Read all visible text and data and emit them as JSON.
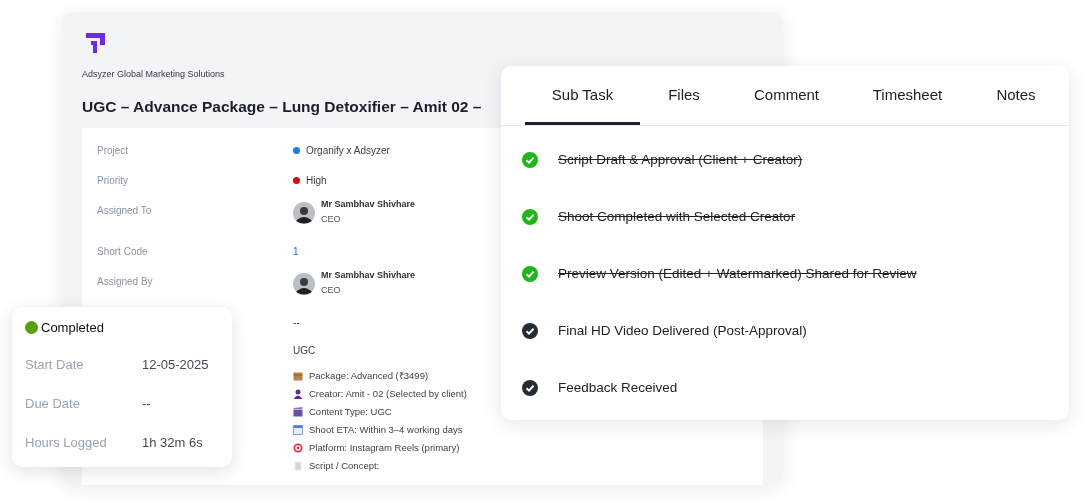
{
  "company": "Adsyzer Global Marketing Solutions",
  "title": "UGC – Advance Package – Lung Detoxifier – Amit 02 –",
  "details": [
    {
      "kind": "dot",
      "label": "Project",
      "value": "Organify x Adsyzer",
      "color": "#1a7cf0"
    },
    {
      "kind": "dot",
      "label": "Priority",
      "value": "High",
      "color": "#d40d0d"
    },
    {
      "kind": "person",
      "label": "Assigned To",
      "name": "Mr Sambhav Shivhare",
      "role": "CEO"
    },
    {
      "kind": "link",
      "label": "Short Code",
      "value": "1"
    },
    {
      "kind": "person",
      "label": "Assigned By",
      "name": "Mr Sambhav Shivhare",
      "role": "CEO"
    },
    {
      "kind": "text",
      "value": "--"
    },
    {
      "kind": "text",
      "value": "UGC"
    },
    {
      "kind": "list",
      "items": [
        {
          "text": "Package: Advanced (₹3499)"
        },
        {
          "text": "Creator: Amit - 02 (Selected by client)"
        },
        {
          "text": "Content Type: UGC"
        },
        {
          "text": "Shoot ETA: Within 3–4 working days"
        },
        {
          "text": "Platform: Instagram Reels (primary)"
        },
        {
          "text": "Script / Concept:"
        }
      ]
    }
  ],
  "status": {
    "label": "Completed",
    "color": "#5a9e0f",
    "rows": [
      {
        "label": "Start Date",
        "value": "12-05-2025"
      },
      {
        "label": "Due Date",
        "value": "--"
      },
      {
        "label": "Hours Logged",
        "value": "1h 32m 6s"
      }
    ]
  },
  "tabs": [
    {
      "label": "Sub Task",
      "selected": true
    },
    {
      "label": "Files",
      "selected": false
    },
    {
      "label": "Comment",
      "selected": false
    },
    {
      "label": "Timesheet",
      "selected": false
    },
    {
      "label": "Notes",
      "selected": false
    }
  ],
  "subtasks": [
    {
      "text": "Script Draft & Approval (Client + Creator)",
      "done": true
    },
    {
      "text": "Shoot Completed with Selected Creator",
      "done": true
    },
    {
      "text": "Preview Version (Edited + Watermarked) Shared for Review",
      "done": true
    },
    {
      "text": "Final HD Video Delivered (Post-Approval)",
      "done": false
    },
    {
      "text": "Feedback Received",
      "done": false
    }
  ]
}
